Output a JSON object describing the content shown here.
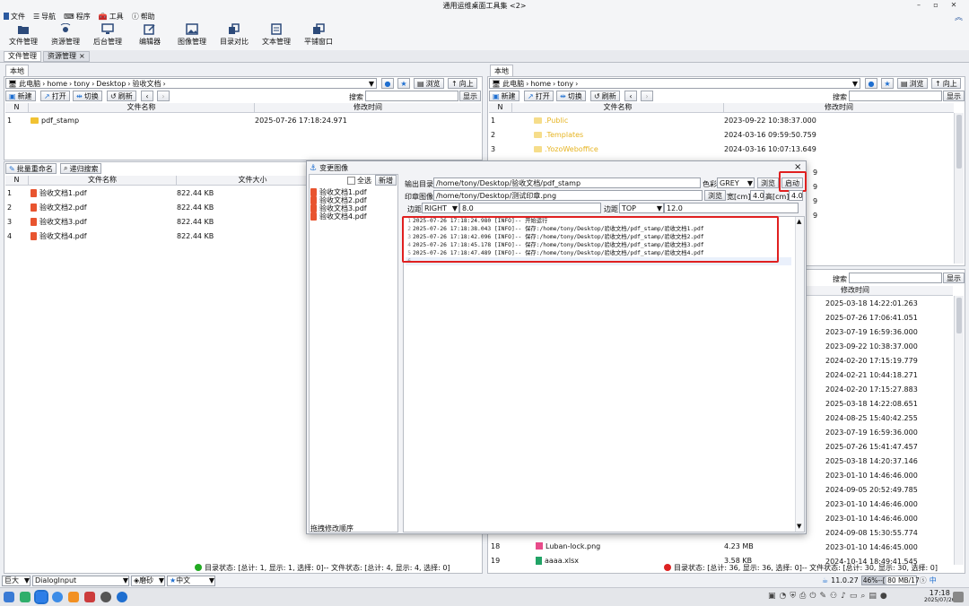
{
  "window": {
    "title": "通用运维桌面工具集 <2>"
  },
  "menu": [
    "文件",
    "导航",
    "程序",
    "工具",
    "帮助"
  ],
  "toolbar": [
    "文件管理",
    "资源管理",
    "后台管理",
    "编辑器",
    "图像管理",
    "目录对比",
    "文本管理",
    "平铺窗口"
  ],
  "tabs": [
    {
      "label": "文件管理"
    },
    {
      "label": "资源管理",
      "close": "×"
    }
  ],
  "left": {
    "subtab": "本地",
    "path": [
      "此电脑",
      "home",
      "tony",
      "Desktop",
      "验收文档"
    ],
    "buttons": {
      "new": "新建",
      "open": "打开",
      "switch": "切换",
      "refresh": "刷新",
      "browse": "浏览",
      "up": "向上",
      "show": "显示"
    },
    "search_label": "搜索",
    "columns": {
      "n": "N",
      "name": "文件名称",
      "mtime": "修改时间"
    },
    "rows": [
      {
        "n": "1",
        "name": "pdf_stamp",
        "mtime": "2025-07-26 17:18:24.971"
      }
    ],
    "lower": {
      "batch_rename": "批量重命名",
      "recursive_search": "递归搜索",
      "columns": {
        "n": "N",
        "name": "文件名称",
        "size": "文件大小"
      },
      "rows": [
        {
          "n": "1",
          "name": "验收文档1.pdf",
          "size": "822.44 KB"
        },
        {
          "n": "2",
          "name": "验收文档2.pdf",
          "size": "822.44 KB"
        },
        {
          "n": "3",
          "name": "验收文档3.pdf",
          "size": "822.44 KB"
        },
        {
          "n": "4",
          "name": "验收文档4.pdf",
          "size": "822.44 KB"
        }
      ],
      "status": "目录状态: [总计: 1, 显示: 1, 选择: 0]-- 文件状态: [总计: 4, 显示: 4, 选择: 0]"
    }
  },
  "right": {
    "subtab": "本地",
    "path": [
      "此电脑",
      "home",
      "tony"
    ],
    "buttons": {
      "new": "新建",
      "open": "打开",
      "switch": "切换",
      "refresh": "刷新",
      "browse": "浏览",
      "up": "向上",
      "show": "显示"
    },
    "search_label": "搜索",
    "columns": {
      "n": "N",
      "name": "文件名称",
      "mtime": "修改时间"
    },
    "rows": [
      {
        "n": "1",
        "name": ".Public",
        "mtime": "2023-09-22 10:38:37.000"
      },
      {
        "n": "2",
        "name": ".Templates",
        "mtime": "2024-03-16 09:59:50.759"
      },
      {
        "n": "3",
        "name": ".YozoWeboffice",
        "mtime": "2024-03-16 10:07:13.649"
      }
    ],
    "partial_digits": [
      "9",
      "9",
      "9",
      "9"
    ],
    "lower": {
      "search_label": "搜索",
      "show": "显示",
      "mtime_header": "修改时间",
      "mtimes": [
        "2025-03-18 14:22:01.263",
        "2025-07-26 17:06:41.051",
        "2023-07-19 16:59:36.000",
        "2023-09-22 10:38:37.000",
        "2024-02-20 17:15:19.779",
        "2024-02-21 10:44:18.271",
        "2024-02-20 17:15:27.883",
        "2025-03-18 14:22:08.651",
        "2024-08-25 15:40:42.255",
        "2023-07-19 16:59:36.000",
        "2025-07-26 15:41:47.457",
        "2025-03-18 14:20:37.146",
        "2023-01-10 14:46:46.000",
        "2024-09-05 20:52:49.785",
        "2023-01-10 14:46:46.000",
        "2023-01-10 14:46:46.000",
        "2024-09-08 15:30:55.774",
        "2023-01-10 14:46:45.000",
        "2024-10-14 18:49:41.545"
      ],
      "rows": [
        {
          "n": "18",
          "name": "Luban-lock.png",
          "size": "4.23 MB"
        },
        {
          "n": "19",
          "name": "aaaa.xlsx",
          "size": "3.58 KB"
        }
      ],
      "status": "目录状态: [总计: 36, 显示: 36, 选择: 0]-- 文件状态: [总计: 30, 显示: 30, 选择: 0]"
    }
  },
  "dialog": {
    "title": "变更图像",
    "close": "×",
    "select_all": "全选",
    "add": "新增",
    "files": [
      "验收文档1.pdf",
      "验收文档2.pdf",
      "验收文档3.pdf",
      "验收文档4.pdf"
    ],
    "footer": "拖拽修改顺序",
    "output_label": "输出目录",
    "output_path": "/home/tony/Desktop/验收文档/pdf_stamp",
    "color_label": "色彩",
    "color_value": "GREY",
    "browse": "浏览",
    "start": "启动",
    "stamp_label": "印章图像",
    "stamp_path": "/home/tony/Desktop/测试印章.png",
    "browse2": "浏览",
    "width_label": "宽[cm]",
    "width_value": "4.0",
    "height_label": "高[cm]",
    "height_value": "4.0",
    "margin1_label": "边距",
    "margin1_dir": "RIGHT",
    "margin1_value": "8.0",
    "margin2_label": "边距",
    "margin2_dir": "TOP",
    "margin2_value": "12.0",
    "log": [
      {
        "n": "1",
        "text": "2025-07-26 17:18:24.980 [INFO]-- 开始运行"
      },
      {
        "n": "2",
        "text": "2025-07-26 17:18:38.043 [INFO]-- 保存:/home/tony/Desktop/验收文档/pdf_stamp/验收文档1.pdf"
      },
      {
        "n": "3",
        "text": "2025-07-26 17:18:42.096 [INFO]-- 保存:/home/tony/Desktop/验收文档/pdf_stamp/验收文档2.pdf"
      },
      {
        "n": "4",
        "text": "2025-07-26 17:18:45.178 [INFO]-- 保存:/home/tony/Desktop/验收文档/pdf_stamp/验收文档3.pdf"
      },
      {
        "n": "5",
        "text": "2025-07-26 17:18:47.489 [INFO]-- 保存:/home/tony/Desktop/验收文档/pdf_stamp/验收文档4.pdf"
      },
      {
        "n": "6",
        "text": ""
      }
    ]
  },
  "bottom": {
    "size": "巨大",
    "font": "DialogInput",
    "theme": "磨砂",
    "lang": "中文"
  },
  "memory": {
    "version": "11.0.27",
    "usage": "46%--[ 80 MB/17",
    "used_fraction": 0.46
  },
  "tray": {
    "ime": "中",
    "time": "17:18",
    "date": "2025/07/26"
  },
  "colors": {
    "accent": "#1f6fd0",
    "highlight": "#e02020",
    "green_dot": "#22aa22",
    "red_dot": "#dd2222",
    "folder": "#f1c232",
    "pdf": "#e8542f"
  }
}
